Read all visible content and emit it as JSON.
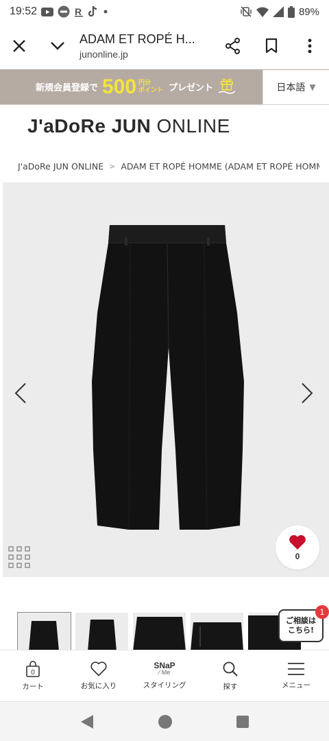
{
  "status_bar": {
    "time": "19:52",
    "battery": "89%"
  },
  "browser": {
    "title": "ADAM ET ROPÉ H...",
    "url": "junonline.jp"
  },
  "promo": {
    "text_left": "新規会員登録で",
    "amount": "500",
    "unit_top": "円分",
    "unit_bottom": "ポイント",
    "text_right": "プレゼント",
    "language": "日本語"
  },
  "logo": {
    "part1": "J'aDoRe JUN",
    "part2": " ONLINE"
  },
  "breadcrumb": {
    "home": "J'aDoRe JUN ONLINE",
    "separator": ">",
    "current": "ADAM ET ROPÉ HOMME (ADAM ET ROPÉ HOMMI"
  },
  "product": {
    "favorite_count": "0"
  },
  "chat": {
    "line1": "ご相談は",
    "line2": "こちら!",
    "badge": "1"
  },
  "bottom_nav": {
    "cart_count": "0",
    "cart": "カート",
    "favorites": "お気に入り",
    "snap_top": "SNaP",
    "snap_bottom": "⁄ Me",
    "styling": "スタイリング",
    "search": "探す",
    "menu": "メニュー"
  }
}
